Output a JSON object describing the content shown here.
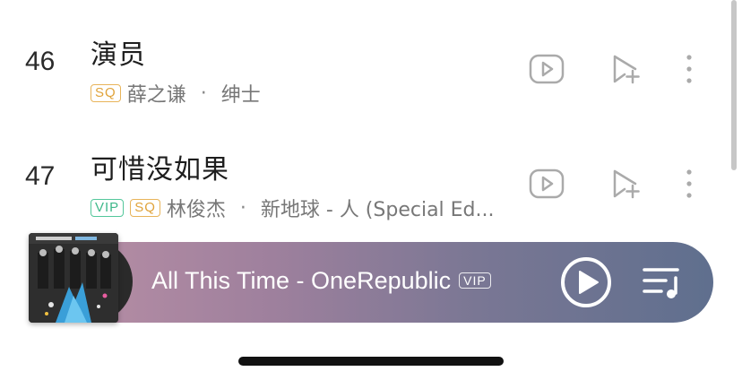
{
  "songs": [
    {
      "number": "46",
      "title": "演员",
      "badges": [
        "SQ"
      ],
      "artist": "薛之谦",
      "separator": "·",
      "album": "绅士"
    },
    {
      "number": "47",
      "title": "可惜没如果",
      "badges": [
        "VIP",
        "SQ"
      ],
      "artist": "林俊杰",
      "separator": "·",
      "album": "新地球 - 人 (Special Ed..."
    }
  ],
  "player": {
    "now_playing": "All This Time - OneRepublic",
    "badge": "VIP"
  },
  "icons": {
    "video": "video-play-icon",
    "add": "add-to-playlist-icon",
    "more": "more-vertical-icon",
    "play": "play-icon",
    "queue": "playlist-queue-icon"
  },
  "colors": {
    "sq_badge": "#e0a33a",
    "vip_badge": "#3fb88a",
    "player_gradient_start": "#bb90a6",
    "player_gradient_end": "#5f6f8e"
  }
}
